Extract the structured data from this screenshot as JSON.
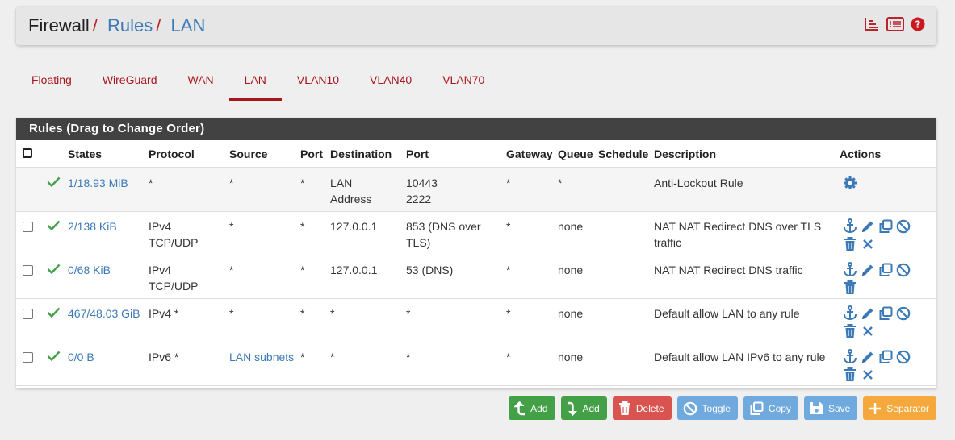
{
  "breadcrumb": {
    "root": "Firewall",
    "rules": "Rules",
    "current": "LAN",
    "sep": "/"
  },
  "header_icons": [
    "chart-icon",
    "list-icon",
    "help-icon"
  ],
  "tabs": [
    {
      "label": "Floating"
    },
    {
      "label": "WireGuard"
    },
    {
      "label": "WAN"
    },
    {
      "label": "LAN"
    },
    {
      "label": "VLAN10"
    },
    {
      "label": "VLAN40"
    },
    {
      "label": "VLAN70"
    }
  ],
  "active_tab": "LAN",
  "panel": {
    "title": "Rules (Drag to Change Order)"
  },
  "columns": {
    "states": "States",
    "protocol": "Protocol",
    "source": "Source",
    "sport": "Port",
    "destination": "Destination",
    "dport": "Port",
    "gateway": "Gateway",
    "queue": "Queue",
    "schedule": "Schedule",
    "description": "Description",
    "actions": "Actions"
  },
  "rows": [
    {
      "states": "1/18.93 MiB",
      "protocol1": "*",
      "protocol2": "",
      "source": "*",
      "sport": "*",
      "dest1": "LAN",
      "dest2": "Address",
      "dport1": "10443",
      "dport2": "2222",
      "gateway": "*",
      "queue": "*",
      "schedule": "",
      "description": "Anti-Lockout Rule"
    },
    {
      "states": "2/138 KiB",
      "protocol1": "IPv4",
      "protocol2": "TCP/UDP",
      "source": "*",
      "sport": "*",
      "dest1": "127.0.0.1",
      "dest2": "",
      "dport1": "853 (DNS over",
      "dport2": "TLS)",
      "gateway": "*",
      "queue": "none",
      "schedule": "",
      "description": "NAT NAT Redirect DNS over TLS traffic"
    },
    {
      "states": "0/68 KiB",
      "protocol1": "IPv4",
      "protocol2": "TCP/UDP",
      "source": "*",
      "sport": "*",
      "dest1": "127.0.0.1",
      "dest2": "",
      "dport1": "53 (DNS)",
      "dport2": "",
      "gateway": "*",
      "queue": "none",
      "schedule": "",
      "description": "NAT NAT Redirect DNS traffic"
    },
    {
      "states": "467/48.03 GiB",
      "protocol1": "IPv4 *",
      "protocol2": "",
      "source": "*",
      "sport": "*",
      "dest1": "*",
      "dest2": "",
      "dport1": "*",
      "dport2": "",
      "gateway": "*",
      "queue": "none",
      "schedule": "",
      "description": "Default allow LAN to any rule"
    },
    {
      "states": "0/0 B",
      "protocol1": "IPv6 *",
      "protocol2": "",
      "source": "LAN subnets",
      "sport": "*",
      "dest1": "*",
      "dest2": "",
      "dport1": "*",
      "dport2": "",
      "gateway": "*",
      "queue": "none",
      "schedule": "",
      "description": "Default allow LAN IPv6 to any rule"
    }
  ],
  "buttons": {
    "add_top": "Add",
    "add_bottom": "Add",
    "delete": "Delete",
    "toggle": "Toggle",
    "copy": "Copy",
    "save": "Save",
    "separator": "Separator"
  },
  "colors": {
    "accent_red": "#a8161d",
    "link_blue": "#3b7ab7",
    "green": "#43a047",
    "panel_dark": "#424242"
  }
}
